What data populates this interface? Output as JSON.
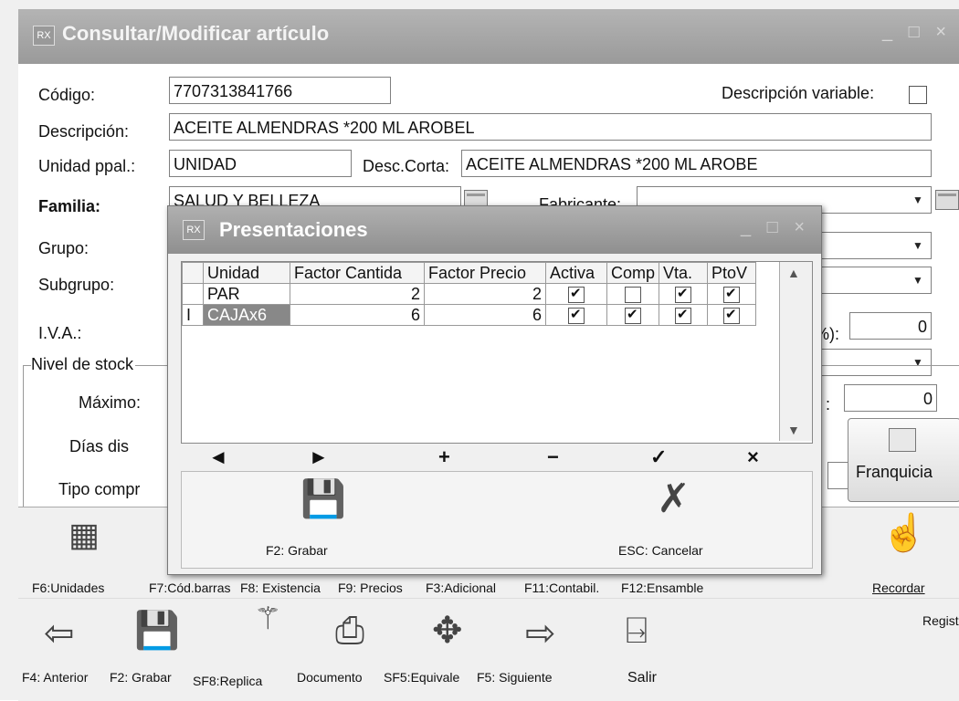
{
  "window": {
    "title": "Consultar/Modificar artículo",
    "controls": "_ □ ×"
  },
  "form": {
    "codigo_label": "Código:",
    "codigo_value": "7707313841766",
    "desc_variable_label": "Descripción variable:",
    "descripcion_label": "Descripción:",
    "descripcion_value": "ACEITE ALMENDRAS *200 ML AROBEL",
    "unidad_label": "Unidad ppal.:",
    "unidad_value": "UNIDAD",
    "desc_corta_label": "Desc.Corta:",
    "desc_corta_value": "ACEITE ALMENDRAS *200 ML AROBE",
    "familia_label": "Familia:",
    "familia_value": "SALUD Y BELLEZA",
    "fabricante_label": "Fabricante:",
    "grupo_label": "Grupo:",
    "subgrupo_label": "Subgrupo:",
    "iva_label": "I.V.A.:",
    "pct_label": "%):",
    "pct_value": "0",
    "nivel_label": "Nivel de stock",
    "maximo_label": "Máximo:",
    "colon": ":",
    "maximo_right_value": "0",
    "dias_label": "Días dis",
    "tipo_label": "Tipo compr",
    "franquicia_label": "Franquicia"
  },
  "toolbar1": {
    "items": [
      "F6:Unidades",
      "F7:Cód.barras",
      "F8: Existencia",
      "F9: Precios",
      "F3:Adicional",
      "F11:Contabil.",
      "F12:Ensamble",
      "Recordar"
    ],
    "registro_label": "Registro"
  },
  "toolbar2": {
    "items": [
      "F4: Anterior",
      "F2: Grabar",
      "SF8:Replica",
      "Documento",
      "SF5:Equivale",
      "F5: Siguiente",
      "Salir"
    ]
  },
  "modal": {
    "title": "Presentaciones",
    "controls": "_ □ ×",
    "columns": [
      "Unidad",
      "Factor Cantida",
      "Factor Precio",
      "Activa",
      "Comp",
      "Vta.",
      "PtoV"
    ],
    "rows": [
      {
        "unidad": "PAR",
        "factor_cantidad": "2",
        "factor_precio": "2",
        "activa": true,
        "comp": false,
        "vta": true,
        "ptov": true,
        "marker": ""
      },
      {
        "unidad": "CAJAx6",
        "factor_cantidad": "6",
        "factor_precio": "6",
        "activa": true,
        "comp": true,
        "vta": true,
        "ptov": true,
        "marker": "I"
      }
    ],
    "nav": {
      "prev": "◄",
      "next": "►",
      "add": "+",
      "remove": "−",
      "confirm": "✓",
      "cancel": "×"
    },
    "grabar_label": "F2: Grabar",
    "cancelar_label": "ESC: Cancelar"
  }
}
